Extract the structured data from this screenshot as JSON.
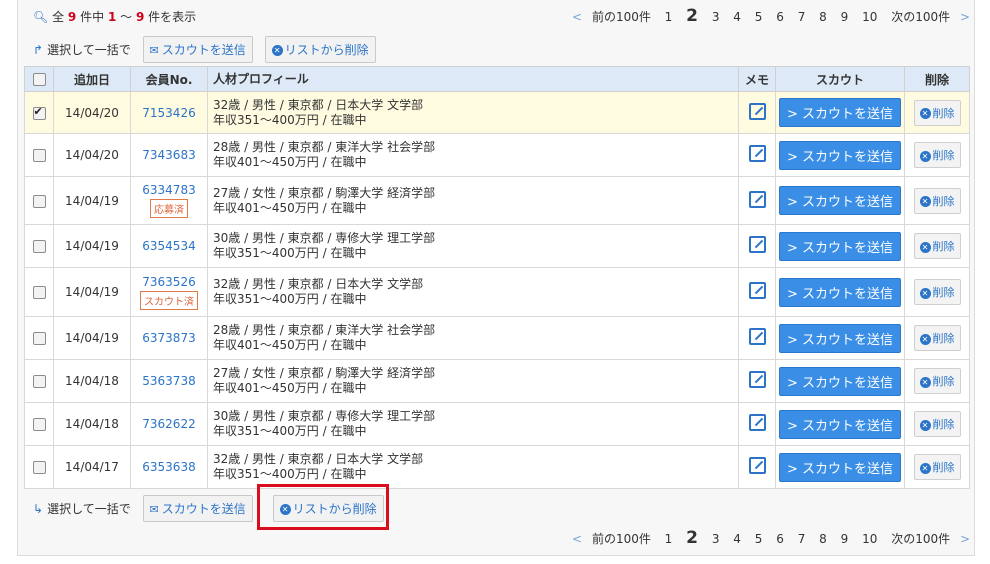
{
  "summary": {
    "prefix": "全",
    "total": "9",
    "mid": "件中",
    "from": "1",
    "sep": "～",
    "to": "9",
    "suffix": "件を表示"
  },
  "pager": {
    "prev": "前の100件",
    "next": "次の100件",
    "pages": [
      "1",
      "2",
      "3",
      "4",
      "5",
      "6",
      "7",
      "8",
      "9",
      "10"
    ],
    "current": "2"
  },
  "bulk": {
    "label": "選択して一括で",
    "scout": "スカウトを送信",
    "remove": "リストから削除"
  },
  "headers": {
    "date": "追加日",
    "id": "会員No.",
    "profile": "人材プロフィール",
    "memo": "メモ",
    "scout": "スカウト",
    "delete": "削除"
  },
  "row_buttons": {
    "scout": "スカウトを送信",
    "delete": "削除"
  },
  "rows": [
    {
      "checked": true,
      "date": "14/04/20",
      "id": "7153426",
      "tag": "",
      "line1": "32歳 / 男性 / 東京都 / 日本大学 文学部",
      "line2": "年収351～400万円 / 在職中"
    },
    {
      "checked": false,
      "date": "14/04/20",
      "id": "7343683",
      "tag": "",
      "line1": "28歳 / 男性 / 東京都 / 東洋大学 社会学部",
      "line2": "年収401～450万円 / 在職中"
    },
    {
      "checked": false,
      "date": "14/04/19",
      "id": "6334783",
      "tag": "応募済",
      "line1": "27歳 / 女性 / 東京都 / 駒澤大学 経済学部",
      "line2": "年収401～450万円 / 在職中"
    },
    {
      "checked": false,
      "date": "14/04/19",
      "id": "6354534",
      "tag": "",
      "line1": "30歳 / 男性 / 東京都 / 専修大学 理工学部",
      "line2": "年収351～400万円 / 在職中"
    },
    {
      "checked": false,
      "date": "14/04/19",
      "id": "7363526",
      "tag": "スカウト済",
      "line1": "32歳 / 男性 / 東京都 / 日本大学 文学部",
      "line2": "年収351～400万円 / 在職中"
    },
    {
      "checked": false,
      "date": "14/04/19",
      "id": "6373873",
      "tag": "",
      "line1": "28歳 / 男性 / 東京都 / 東洋大学 社会学部",
      "line2": "年収401～450万円 / 在職中"
    },
    {
      "checked": false,
      "date": "14/04/18",
      "id": "5363738",
      "tag": "",
      "line1": "27歳 / 女性 / 東京都 / 駒澤大学 経済学部",
      "line2": "年収401～450万円 / 在職中"
    },
    {
      "checked": false,
      "date": "14/04/18",
      "id": "7362622",
      "tag": "",
      "line1": "30歳 / 男性 / 東京都 / 専修大学 理工学部",
      "line2": "年収351～400万円 / 在職中"
    },
    {
      "checked": false,
      "date": "14/04/17",
      "id": "6353638",
      "tag": "",
      "line1": "32歳 / 男性 / 東京都 / 日本大学 文学部",
      "line2": "年収351～400万円 / 在職中"
    }
  ],
  "colors": {
    "accent": "#2b74c7",
    "button": "#3a8ee6",
    "highlight": "#d90d1e",
    "selected_row": "#fffbe0",
    "header_bg": "#dde9f6"
  }
}
